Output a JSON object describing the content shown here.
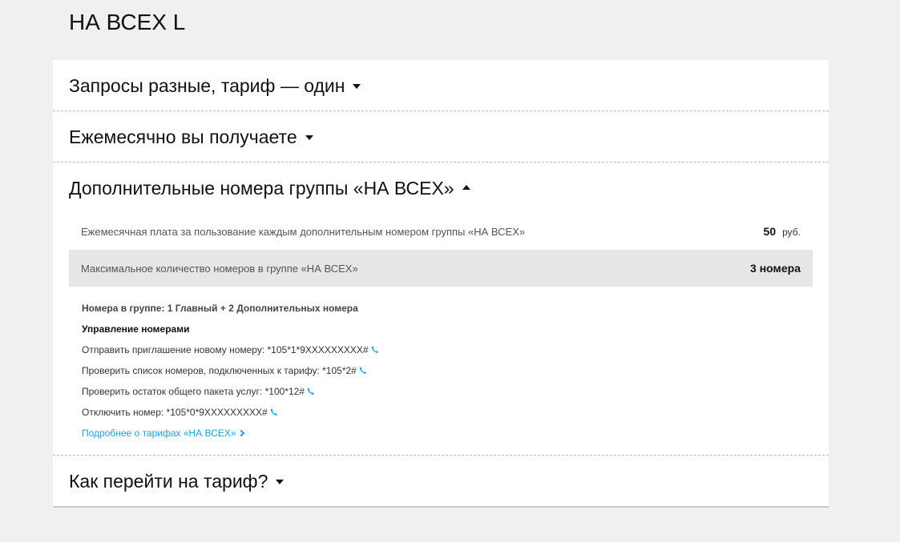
{
  "page": {
    "title": "НА ВСЕХ L"
  },
  "sections": [
    {
      "label": "Запросы разные, тариф — один",
      "expanded": false
    },
    {
      "label": "Ежемесячно вы получаете",
      "expanded": false
    },
    {
      "label": "Дополнительные номера группы «НА ВСЕХ»",
      "expanded": true
    },
    {
      "label": "Как перейти на тариф?",
      "expanded": false
    }
  ],
  "details": {
    "rows": [
      {
        "label": "Ежемесячная плата за пользование каждым дополнительным номером группы «НА ВСЕХ»",
        "value": "50",
        "unit": "руб."
      },
      {
        "label": "Максимальное количество номеров в группе «НА ВСЕХ»",
        "value": "3 номера"
      }
    ],
    "group_numbers": "Номера в группе: 1 Главный + 2 Дополнительных номера",
    "management_heading": "Управление номерами",
    "commands": [
      {
        "text": "Отправить приглашение новому номеру: *105*1*9XXXXXXXXX#"
      },
      {
        "text": "Проверить список номеров, подключенных к тарифу: *105*2#"
      },
      {
        "text": "Проверить остаток общего пакета услуг: *100*12#"
      },
      {
        "text": "Отключить номер: *105*0*9XXXXXXXXX#"
      }
    ],
    "more_link": "Подробнее о тарифах «НА ВСЕХ»"
  },
  "colors": {
    "background": "#f0f0f0",
    "card": "#ffffff",
    "shaded_row": "#e6e6e6",
    "link": "#1a9fdc",
    "text": "#111111"
  },
  "icons": {
    "phone": "phone-icon",
    "caret_down": "caret-down-icon",
    "caret_up": "caret-up-icon",
    "chevron_right": "chevron-right-icon"
  }
}
